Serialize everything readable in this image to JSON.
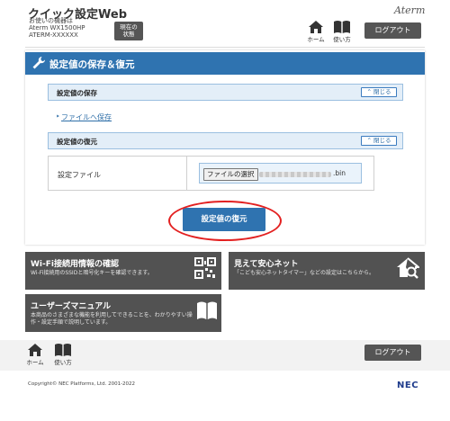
{
  "header": {
    "app_title": "クイック設定Web",
    "device_lines": [
      "お使いの機器は",
      "Aterm WX1500HP",
      "ATERM-XXXXXX"
    ],
    "status_button": [
      "現在の",
      "状態"
    ],
    "brand_logo": "Aterm",
    "home_label": "ホーム",
    "howto_label": "使い方",
    "logout_label": "ログアウト"
  },
  "page": {
    "title": "設定値の保存＆復元",
    "save_section": {
      "title": "設定値の保存",
      "close_label": "閉じる",
      "link": "ファイルへ保存"
    },
    "restore_section": {
      "title": "設定値の復元",
      "close_label": "閉じる"
    },
    "file_field": {
      "label": "設定ファイル",
      "choose_button": "ファイルの選択",
      "file_extension": ".bin"
    },
    "restore_button": "設定値の復元"
  },
  "promos": [
    {
      "title": "Wi-Fi接続用情報の確認",
      "desc": "Wi-Fi接続用のSSIDと暗号化キーを確認できます。",
      "icon": "qr-code-icon"
    },
    {
      "title": "見えて安心ネット",
      "desc": "「こども安心ネットタイマー」などの設定はこちらから。",
      "icon": "house-search-icon"
    },
    {
      "title": "ユーザーズマニュアル",
      "desc": "本商品のさまざまな機能を利用してできることを、わかりやすい操\n作・設定手順で説明しています。",
      "icon": "book-icon"
    }
  ],
  "footer": {
    "home_label": "ホーム",
    "howto_label": "使い方",
    "logout_label": "ログアウト",
    "copyright": "Copyright© NEC Platforms, Ltd. 2001-2022",
    "nec_logo": "NEC"
  },
  "colors": {
    "accent_blue": "#2f73b0",
    "dark_gray": "#525252",
    "highlight_red": "#e32020",
    "section_bg": "#e3eef8"
  }
}
